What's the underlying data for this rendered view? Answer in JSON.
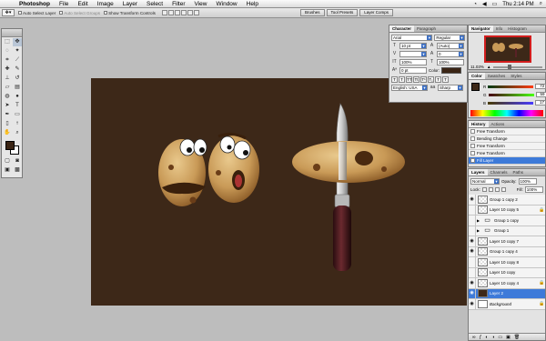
{
  "menubar": {
    "app": "Photoshop",
    "items": [
      "File",
      "Edit",
      "Image",
      "Layer",
      "Select",
      "Filter",
      "View",
      "Window",
      "Help"
    ],
    "clock": "Thu 2:14 PM"
  },
  "options": {
    "auto_select_layer": "Auto Select Layer",
    "auto_select_groups": "Auto Select Groups",
    "show_transform_controls": "Show Transform Controls"
  },
  "wells": [
    "Brushes",
    "Tool Presets",
    "Layer Comps"
  ],
  "character": {
    "tabs": [
      "Character",
      "Paragraph"
    ],
    "font_family": "Arial",
    "font_style": "Regular",
    "font_size": "10 pt",
    "leading": "(Auto)",
    "kerning": "",
    "tracking": "0",
    "vscale": "100%",
    "hscale": "100%",
    "baseline": "0 pt",
    "color_label": "Color:",
    "language": "English: USA",
    "antialias": "Sharp",
    "style_buttons": [
      "T",
      "T",
      "TT",
      "Tt",
      "T¹",
      "T₁",
      "T",
      "T"
    ]
  },
  "navigator": {
    "tabs": [
      "Navigator",
      "Info",
      "Histogram"
    ],
    "zoom": "11.03%"
  },
  "color": {
    "tabs": [
      "Color",
      "Swatches",
      "Styles"
    ],
    "r": "72",
    "g": "59",
    "b": "17",
    "accent": "#3d2818"
  },
  "history": {
    "tabs": [
      "History",
      "Actions"
    ],
    "items": [
      "Free Transform",
      "Bending Change",
      "Free Transform",
      "Free Transform",
      "Fill Layer"
    ]
  },
  "layers": {
    "tabs": [
      "Layers",
      "Channels",
      "Paths"
    ],
    "blend_mode": "Normal",
    "opacity_label": "Opacity:",
    "opacity": "100%",
    "lock_label": "Lock:",
    "fill_label": "Fill:",
    "fill": "100%",
    "items": [
      {
        "name": "Group 1 copy 2",
        "type": "layer"
      },
      {
        "name": "Layer 10 copy 5",
        "type": "layer",
        "locked": true
      },
      {
        "name": "Group 1 copy",
        "type": "group"
      },
      {
        "name": "Group 1",
        "type": "group"
      },
      {
        "name": "Layer 10 copy 7",
        "type": "layer"
      },
      {
        "name": "Group 1 copy 4",
        "type": "layer"
      },
      {
        "name": "Layer 10 copy 8",
        "type": "layer"
      },
      {
        "name": "Layer 10 copy",
        "type": "layer"
      },
      {
        "name": "Layer 10 copy 4",
        "type": "layer",
        "locked": true
      },
      {
        "name": "Layer 2",
        "type": "layer",
        "selected": true
      },
      {
        "name": "Background",
        "type": "background",
        "locked": true
      }
    ]
  }
}
